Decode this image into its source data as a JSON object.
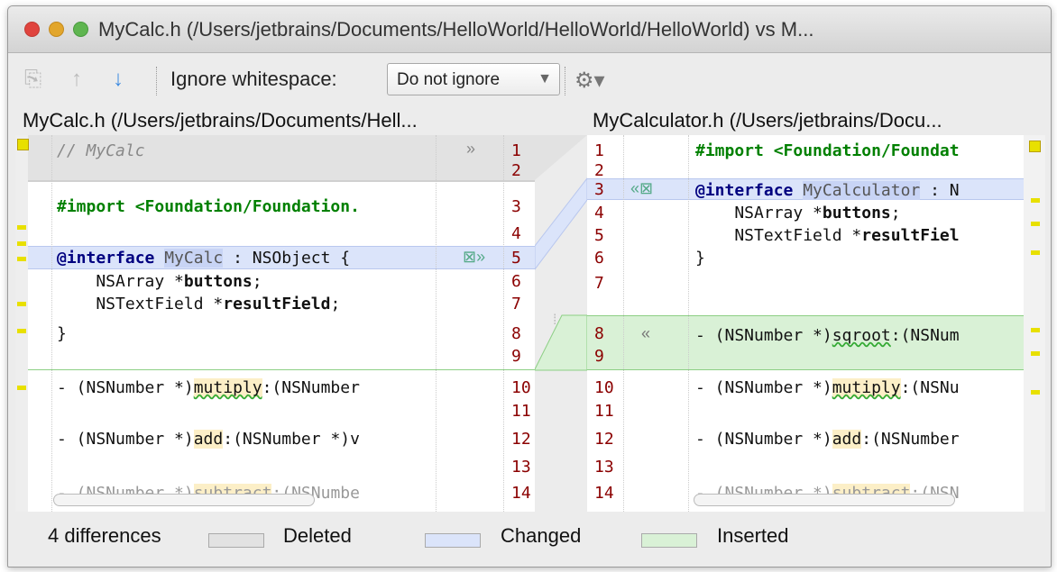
{
  "window": {
    "title": "MyCalc.h (/Users/jetbrains/Documents/HelloWorld/HelloWorld/HelloWorld) vs M..."
  },
  "toolbar": {
    "ignore_label": "Ignore whitespace:",
    "ignore_value": "Do not ignore",
    "copy_icon": "copy-icon",
    "prev_icon": "arrow-up-icon",
    "next_icon": "arrow-down-icon",
    "settings_icon": "gear-icon"
  },
  "left": {
    "title": "MyCalc.h (/Users/jetbrains/Documents/Hell...",
    "line_numbers": [
      "1",
      "2",
      "3",
      "4",
      "5",
      "6",
      "7",
      "8",
      "9",
      "10",
      "11",
      "12",
      "13",
      "14"
    ]
  },
  "right": {
    "title": "MyCalculator.h (/Users/jetbrains/Docu...",
    "line_numbers": [
      "1",
      "2",
      "3",
      "4",
      "5",
      "6",
      "7",
      "8",
      "9",
      "10",
      "11",
      "12",
      "13",
      "14"
    ]
  },
  "footer": {
    "count": "4 differences",
    "deleted": "Deleted",
    "changed": "Changed",
    "inserted": "Inserted"
  },
  "colors": {
    "deleted": "#e2e2e2",
    "changed": "#dbe4fa",
    "inserted": "#d9f1d6"
  }
}
